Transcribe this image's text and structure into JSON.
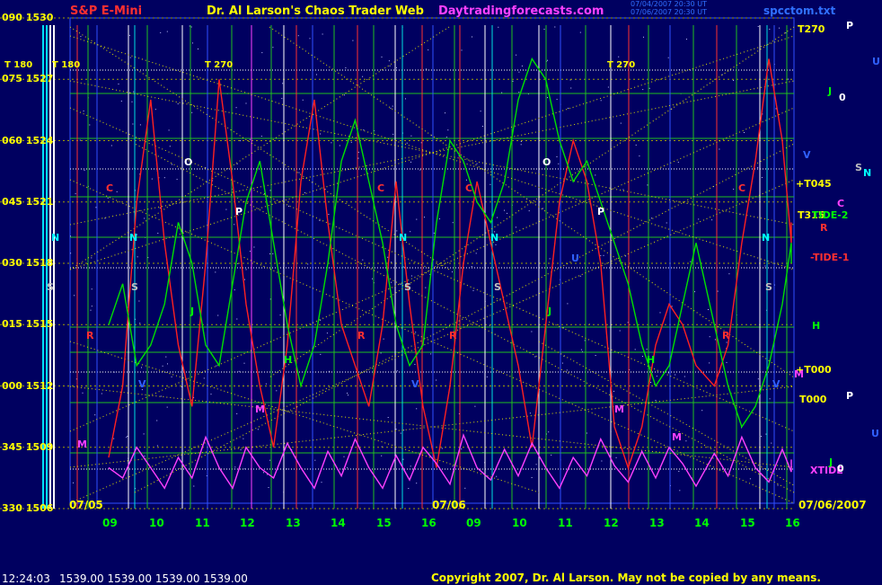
{
  "header": {
    "symbol": "S&P E-Mini",
    "title": "Dr. Al Larson's Chaos Trader Web",
    "site": "Daytradingforecasts.com",
    "stamp1": "07/04/2007 20:30 UT",
    "stamp2": "07/06/2007 20:30 UT",
    "file": "spcctom.txt"
  },
  "status": {
    "time": "12:24:03",
    "quotes": "1539.00 1539.00 1539.00 1539.00"
  },
  "copyright": "Copyright 2007, Dr. Al Larson. May not be copied by any means.",
  "chart_data": {
    "type": "line",
    "price_axis_labels": [
      {
        "deg": "090",
        "price": "1530"
      },
      {
        "deg": "075",
        "price": "1527"
      },
      {
        "deg": "060",
        "price": "1524"
      },
      {
        "deg": "045",
        "price": "1521"
      },
      {
        "deg": "030",
        "price": "1518"
      },
      {
        "deg": "015",
        "price": "1515"
      },
      {
        "deg": "000",
        "price": "1512"
      },
      {
        "deg": "345",
        "price": "1509"
      },
      {
        "deg": "330",
        "price": "1506"
      }
    ],
    "ylim": [
      1506,
      1530
    ],
    "hour_ticks": [
      "09",
      "10",
      "11",
      "12",
      "13",
      "14",
      "15",
      "16",
      "09",
      "10",
      "11",
      "12",
      "13",
      "14",
      "15",
      "16"
    ],
    "date_labels": [
      "07/05",
      "07/06"
    ],
    "end_date": "07/06/2007",
    "left_markers": [
      "T 180",
      "T 180"
    ],
    "time_markers": [
      "T 270",
      "T 270"
    ],
    "right_labels": [
      {
        "text": "T270",
        "color": "#ffff00"
      },
      {
        "text": "+T045",
        "color": "#ffff00"
      },
      {
        "text": "T315",
        "color": "#ffff00"
      },
      {
        "text": "TIDE-2",
        "color": "#00ff00"
      },
      {
        "text": "-TIDE-1",
        "color": "#ff3030"
      },
      {
        "text": "+T000",
        "color": "#ffff00"
      },
      {
        "text": "T000",
        "color": "#ffff00"
      },
      {
        "text": "XTIDE",
        "color": "#ff40ff"
      }
    ],
    "planet_letters": [
      {
        "text": "P",
        "color": "#ffffff"
      },
      {
        "text": "U",
        "color": "#3060ff"
      },
      {
        "text": "J",
        "color": "#00ff00"
      },
      {
        "text": "0",
        "color": "#ffffff"
      },
      {
        "text": "V",
        "color": "#3060ff"
      },
      {
        "text": "S",
        "color": "#c0c0c0"
      },
      {
        "text": "N",
        "color": "#00ffff"
      },
      {
        "text": "C",
        "color": "#ff40ff"
      },
      {
        "text": "R",
        "color": "#ff3030"
      },
      {
        "text": "H",
        "color": "#00ff00"
      },
      {
        "text": "M",
        "color": "#ff40ff"
      },
      {
        "text": "P",
        "color": "#ffffff"
      },
      {
        "text": "U",
        "color": "#3060ff"
      },
      {
        "text": "J",
        "color": "#00ff00"
      },
      {
        "text": "0",
        "color": "#ffffff"
      }
    ],
    "plot_letters": [
      {
        "text": "O",
        "color": "#ffffff"
      },
      {
        "text": "O",
        "color": "#ffffff"
      },
      {
        "text": "P",
        "color": "#ffffff"
      },
      {
        "text": "P",
        "color": "#ffffff"
      },
      {
        "text": "C",
        "color": "#ff3030"
      },
      {
        "text": "C",
        "color": "#ff3030"
      },
      {
        "text": "C",
        "color": "#ff3030"
      },
      {
        "text": "C",
        "color": "#ff3030"
      },
      {
        "text": "N",
        "color": "#00ffff"
      },
      {
        "text": "N",
        "color": "#00ffff"
      },
      {
        "text": "N",
        "color": "#00ffff"
      },
      {
        "text": "N",
        "color": "#00ffff"
      },
      {
        "text": "N",
        "color": "#00ffff"
      },
      {
        "text": "S",
        "color": "#c0c0c0"
      },
      {
        "text": "S",
        "color": "#c0c0c0"
      },
      {
        "text": "S",
        "color": "#c0c0c0"
      },
      {
        "text": "S",
        "color": "#c0c0c0"
      },
      {
        "text": "S",
        "color": "#c0c0c0"
      },
      {
        "text": "H",
        "color": "#00ff00"
      },
      {
        "text": "H",
        "color": "#00ff00"
      },
      {
        "text": "M",
        "color": "#ff40ff"
      },
      {
        "text": "M",
        "color": "#ff40ff"
      },
      {
        "text": "M",
        "color": "#ff40ff"
      },
      {
        "text": "M",
        "color": "#ff40ff"
      },
      {
        "text": "R",
        "color": "#ff3030"
      },
      {
        "text": "R",
        "color": "#ff3030"
      },
      {
        "text": "R",
        "color": "#ff3030"
      },
      {
        "text": "R",
        "color": "#ff3030"
      },
      {
        "text": "V",
        "color": "#3060ff"
      },
      {
        "text": "V",
        "color": "#3060ff"
      },
      {
        "text": "V",
        "color": "#3060ff"
      },
      {
        "text": "U",
        "color": "#3060ff"
      },
      {
        "text": "J",
        "color": "#00ff00"
      },
      {
        "text": "J",
        "color": "#00ff00"
      }
    ],
    "series": [
      {
        "color": "#ff2020",
        "x": [
          0,
          0.3,
          0.6,
          0.9,
          1.2,
          1.5,
          1.8,
          2.1,
          2.4,
          2.7,
          3.0,
          3.3,
          3.6,
          3.9,
          4.2,
          4.5,
          4.8,
          5.1,
          5.4,
          5.7,
          6.0,
          6.3,
          6.6,
          6.9,
          7.2,
          7.5,
          7.8,
          8.1,
          8.4,
          8.7,
          9.0,
          9.3,
          9.6,
          9.9,
          10.2,
          10.5,
          10.8,
          11.1,
          11.4,
          11.7,
          12.0,
          12.3,
          12.6,
          12.9,
          13.3,
          13.6,
          13.9,
          14.2,
          14.5,
          14.8,
          15.1,
          15.4
        ],
        "y": [
          1508.5,
          1512,
          1521,
          1526,
          1519,
          1514,
          1511,
          1518,
          1527,
          1522,
          1516,
          1512,
          1509,
          1514,
          1522,
          1526,
          1520,
          1515,
          1513,
          1511,
          1515,
          1522,
          1516,
          1511,
          1508,
          1512,
          1518,
          1522,
          1519,
          1516,
          1513,
          1509,
          1515,
          1521,
          1524,
          1522,
          1518,
          1510,
          1508,
          1510,
          1514,
          1516,
          1515,
          1513,
          1512,
          1514,
          1519,
          1523,
          1528,
          1524,
          1519,
          1520
        ]
      },
      {
        "color": "#00e000",
        "x": [
          0,
          0.3,
          0.6,
          0.9,
          1.2,
          1.5,
          1.8,
          2.1,
          2.4,
          2.7,
          3.0,
          3.3,
          3.6,
          3.9,
          4.2,
          4.5,
          4.8,
          5.1,
          5.4,
          5.7,
          6.0,
          6.3,
          6.6,
          6.9,
          7.2,
          7.5,
          7.8,
          8.1,
          8.4,
          8.7,
          9.0,
          9.3,
          9.6,
          9.9,
          10.2,
          10.5,
          10.8,
          11.1,
          11.4,
          11.7,
          12.0,
          12.3,
          12.6,
          12.9,
          13.3,
          13.6,
          13.9,
          14.2,
          14.5,
          14.8,
          15.1,
          15.4
        ],
        "y": [
          1515,
          1517,
          1513,
          1514,
          1516,
          1520,
          1518,
          1514,
          1513,
          1517,
          1521,
          1523,
          1519,
          1515,
          1512,
          1514,
          1518,
          1523,
          1525,
          1522,
          1519,
          1515,
          1513,
          1514,
          1520,
          1524,
          1523,
          1521,
          1520,
          1522,
          1526,
          1528,
          1527,
          1524,
          1522,
          1523,
          1521,
          1519,
          1517,
          1514,
          1512,
          1513,
          1516,
          1519,
          1515,
          1512,
          1510,
          1511,
          1513,
          1516,
          1519,
          1518
        ]
      },
      {
        "color": "#ff40ff",
        "x": [
          0,
          0.3,
          0.6,
          0.9,
          1.2,
          1.5,
          1.8,
          2.1,
          2.4,
          2.7,
          3.0,
          3.3,
          3.6,
          3.9,
          4.2,
          4.5,
          4.8,
          5.1,
          5.4,
          5.7,
          6.0,
          6.3,
          6.6,
          6.9,
          7.2,
          7.5,
          7.8,
          8.1,
          8.4,
          8.7,
          9.0,
          9.3,
          9.6,
          9.9,
          10.2,
          10.5,
          10.8,
          11.1,
          11.4,
          11.7,
          12.0,
          12.3,
          12.6,
          12.9,
          13.3,
          13.6,
          13.9,
          14.2,
          14.5,
          14.8,
          15.1,
          15.4
        ],
        "y": [
          1508,
          1507.5,
          1509,
          1508,
          1507,
          1508.5,
          1507.5,
          1509.5,
          1508,
          1507,
          1509,
          1508,
          1507.5,
          1509.2,
          1508,
          1507,
          1508.8,
          1507.6,
          1509.4,
          1508,
          1507,
          1508.6,
          1507.4,
          1509,
          1508.2,
          1507.2,
          1509.6,
          1508,
          1507.4,
          1508.9,
          1507.6,
          1509.2,
          1508,
          1507,
          1508.5,
          1507.6,
          1509.4,
          1508.1,
          1507.3,
          1508.8,
          1507.5,
          1509,
          1508.2,
          1507.1,
          1508.7,
          1507.6,
          1509.5,
          1508,
          1507.3,
          1508.9,
          1507.8,
          1508.4
        ]
      }
    ],
    "grid": true,
    "legend": "none"
  }
}
